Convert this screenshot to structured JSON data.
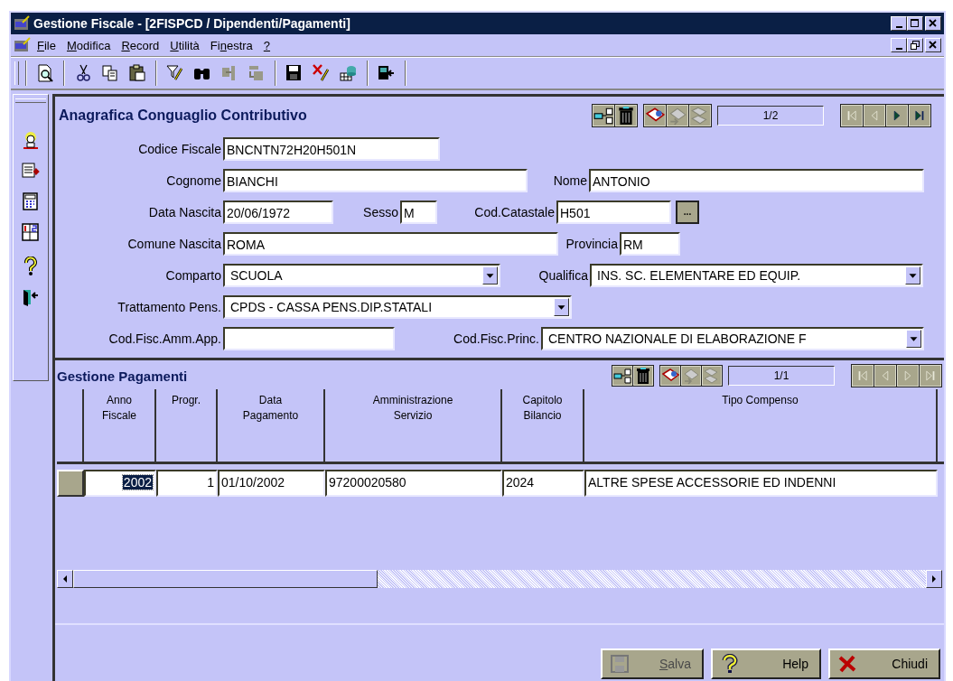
{
  "window": {
    "title": "Gestione Fiscale - [2FISPCD / Dipendenti/Pagamenti]"
  },
  "menu": [
    {
      "label": "File"
    },
    {
      "label": "Modifica"
    },
    {
      "label": "Record"
    },
    {
      "label": "Utilità"
    },
    {
      "label": "Finestra"
    },
    {
      "label": "?"
    }
  ],
  "form": {
    "title": "Anagrafica Conguaglio Contributivo",
    "pager": "1/2",
    "nav": [
      {
        "kind": "first",
        "disabled": true
      },
      {
        "kind": "prev",
        "disabled": true
      },
      {
        "kind": "next",
        "disabled": false
      },
      {
        "kind": "last",
        "disabled": false
      }
    ],
    "rows": [
      [
        {
          "kind": "text",
          "label": "Codice Fiscale",
          "value": "BNCNTN72H20H501N"
        }
      ],
      [
        {
          "kind": "text",
          "label": "Cognome",
          "value": "BIANCHI"
        },
        {
          "kind": "text",
          "label": "Nome",
          "value": "ANTONIO"
        }
      ],
      [
        {
          "kind": "text",
          "label": "Data Nascita",
          "value": "20/06/1972"
        },
        {
          "kind": "text",
          "label": "Sesso",
          "value": "M"
        },
        {
          "kind": "text",
          "label": "Cod.Catastale",
          "value": "H501"
        },
        {
          "kind": "lookup",
          "value": "..."
        }
      ],
      [
        {
          "kind": "text",
          "label": "Comune Nascita",
          "value": "ROMA"
        },
        {
          "kind": "text",
          "label": "Provincia",
          "value": "RM"
        }
      ],
      [
        {
          "kind": "select",
          "label": "Comparto",
          "value": "SCUOLA"
        },
        {
          "kind": "select",
          "label": "Qualifica",
          "value": "INS. SC. ELEMENTARE ED EQUIP."
        }
      ],
      [
        {
          "kind": "select",
          "label": "Trattamento Pens.",
          "value": "CPDS - CASSA PENS.DIP.STATALI"
        }
      ],
      [
        {
          "kind": "text",
          "label": "Cod.Fisc.Amm.App."
        },
        {
          "kind": "select",
          "label": "Cod.Fisc.Princ.",
          "value": "CENTRO NAZIONALE DI ELABORAZIONE F"
        }
      ]
    ]
  },
  "grid": {
    "title": "Gestione Pagamenti",
    "pager": "1/1",
    "nav": [
      {
        "kind": "first",
        "disabled": true
      },
      {
        "kind": "prev",
        "disabled": true
      },
      {
        "kind": "next",
        "disabled": true
      },
      {
        "kind": "last",
        "disabled": true
      }
    ],
    "columns": [
      "Anno Fiscale",
      "Progr.",
      "Data Pagamento",
      "Amministrazione Servizio",
      "Capitolo Bilancio",
      "Tipo Compenso"
    ],
    "rows": [
      {
        "cells": [
          {
            "value": "2002",
            "selected": true
          },
          {
            "value": "1",
            "selected": false
          },
          {
            "value": "01/10/2002",
            "selected": false
          },
          {
            "value": "97200020580",
            "selected": false
          },
          {
            "value": "2024",
            "selected": false
          },
          {
            "value": "ALTRE SPESE ACCESSORIE ED INDENNI",
            "selected": false
          }
        ]
      }
    ]
  },
  "buttons": [
    {
      "kind": "save",
      "label": "Salva",
      "disabled": true
    },
    {
      "kind": "help",
      "label": "Help",
      "disabled": false
    },
    {
      "kind": "close",
      "label": "Chiudi",
      "disabled": false
    }
  ]
}
